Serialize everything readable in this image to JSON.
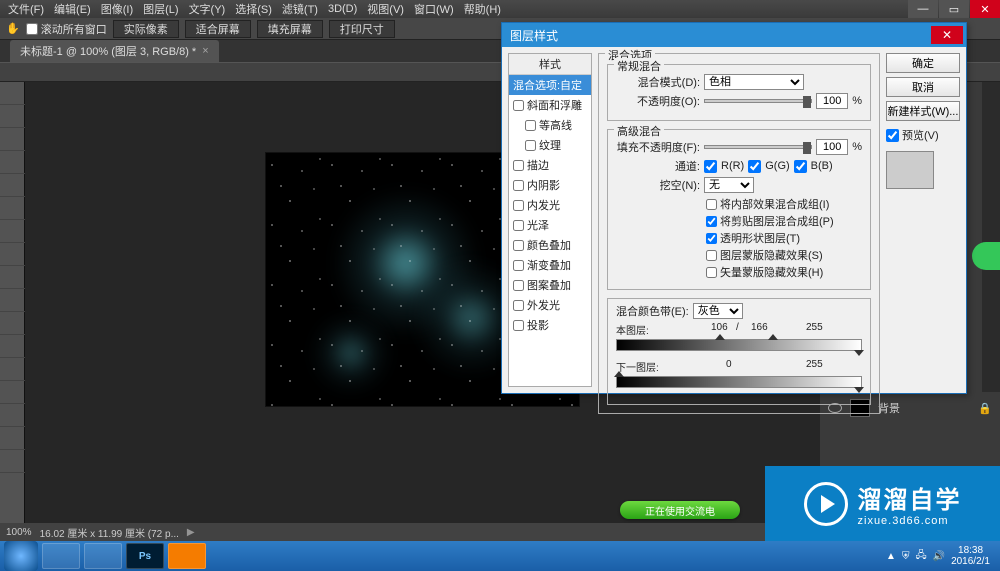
{
  "menu": [
    "文件(F)",
    "编辑(E)",
    "图像(I)",
    "图层(L)",
    "文字(Y)",
    "选择(S)",
    "滤镜(T)",
    "3D(D)",
    "视图(V)",
    "窗口(W)",
    "帮助(H)"
  ],
  "optbar": {
    "scroll_all": "滚动所有窗口",
    "b1": "实际像素",
    "b2": "适合屏幕",
    "b3": "填充屏幕",
    "b4": "打印尺寸"
  },
  "tab": {
    "title": "未标题-1 @ 100% (图层 3, RGB/8) *"
  },
  "status": {
    "zoom": "100%",
    "size": "16.02 厘米 x 11.99 厘米 (72 p..."
  },
  "pill": "正在使用交流电",
  "watermark": {
    "big": "溜溜自学",
    "small": "zixue.3d66.com"
  },
  "layers_mini": {
    "bg": "背景"
  },
  "taskbar": {
    "time": "18:38",
    "date": "2016/2/1"
  },
  "dialog": {
    "title": "图层样式",
    "styles_header": "样式",
    "blend_opts": "混合选项:自定",
    "styles": [
      "斜面和浮雕",
      "等高线",
      "纹理",
      "描边",
      "内阴影",
      "内发光",
      "光泽",
      "颜色叠加",
      "渐变叠加",
      "图案叠加",
      "外发光",
      "投影"
    ],
    "group_main": "混合选项",
    "group_general": "常规混合",
    "blend_mode_lab": "混合模式(D):",
    "blend_mode_val": "色相",
    "opacity_lab": "不透明度(O):",
    "opacity_val": "100",
    "pct": "%",
    "group_adv": "高级混合",
    "fill_lab": "填充不透明度(F):",
    "fill_val": "100",
    "channels_lab": "通道:",
    "ch_r": "R(R)",
    "ch_g": "G(G)",
    "ch_b": "B(B)",
    "knockout_lab": "挖空(N):",
    "knockout_val": "无",
    "adv_checks": [
      {
        "label": "将内部效果混合成组(I)",
        "checked": false
      },
      {
        "label": "将剪贴图层混合成组(P)",
        "checked": true
      },
      {
        "label": "透明形状图层(T)",
        "checked": true
      },
      {
        "label": "图层蒙版隐藏效果(S)",
        "checked": false
      },
      {
        "label": "矢量蒙版隐藏效果(H)",
        "checked": false
      }
    ],
    "blendif_lab": "混合颜色带(E):",
    "blendif_val": "灰色",
    "this_layer": "本图层:",
    "this_vals": [
      "106",
      "/",
      "166",
      "255"
    ],
    "under_layer": "下一图层:",
    "under_vals": [
      "0",
      "255"
    ],
    "btn_ok": "确定",
    "btn_cancel": "取消",
    "btn_new": "新建样式(W)...",
    "preview": "预览(V)"
  }
}
